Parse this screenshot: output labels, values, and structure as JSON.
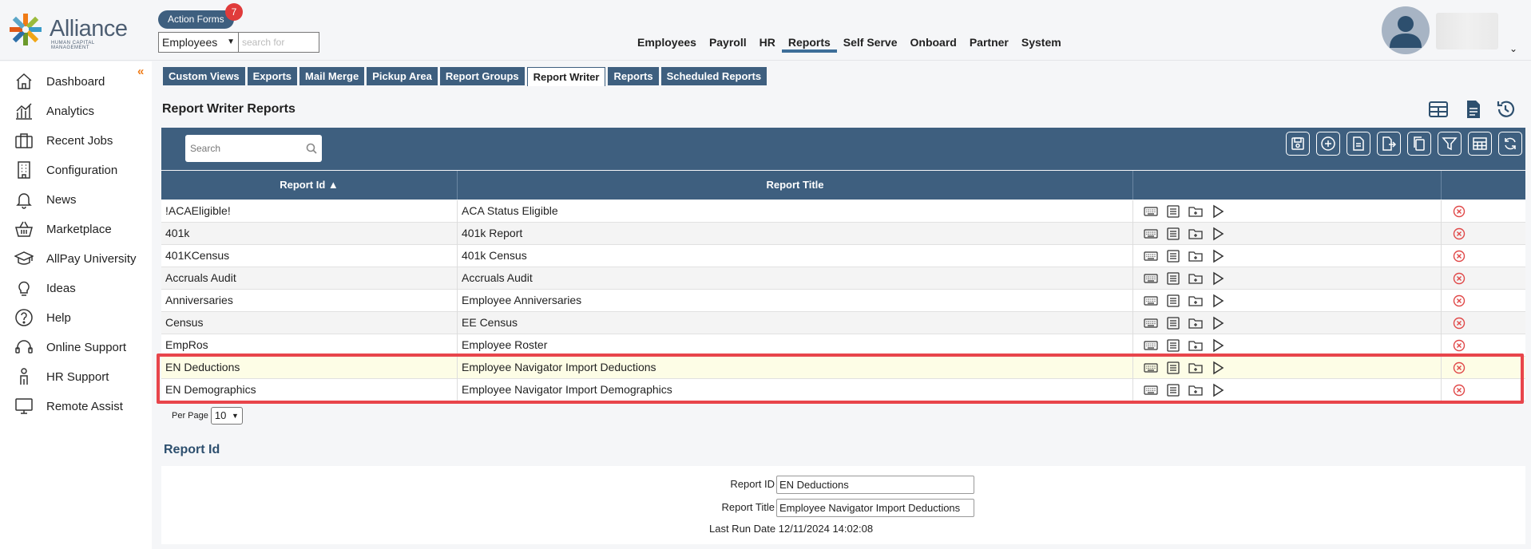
{
  "header": {
    "logo_word": "Alliance",
    "logo_sub": "HUMAN CAPITAL MANAGEMENT",
    "action_forms_label": "Action Forms",
    "action_forms_count": "7",
    "search_scope": "Employees",
    "search_placeholder": "search for",
    "nav": [
      "Employees",
      "Payroll",
      "HR",
      "Reports",
      "Self Serve",
      "Onboard",
      "Partner",
      "System"
    ],
    "active_nav": "Reports"
  },
  "sidebar": {
    "items": [
      {
        "label": "Dashboard",
        "icon": "home-icon"
      },
      {
        "label": "Analytics",
        "icon": "analytics-icon"
      },
      {
        "label": "Recent Jobs",
        "icon": "briefcase-icon"
      },
      {
        "label": "Configuration",
        "icon": "building-icon"
      },
      {
        "label": "News",
        "icon": "bell-icon"
      },
      {
        "label": "Marketplace",
        "icon": "basket-icon"
      },
      {
        "label": "AllPay University",
        "icon": "graduation-cap-icon"
      },
      {
        "label": "Ideas",
        "icon": "lightbulb-icon"
      },
      {
        "label": "Help",
        "icon": "question-icon"
      },
      {
        "label": "Online Support",
        "icon": "headset-icon"
      },
      {
        "label": "HR Support",
        "icon": "person-icon"
      },
      {
        "label": "Remote Assist",
        "icon": "monitor-icon"
      }
    ]
  },
  "tabs": [
    "Custom Views",
    "Exports",
    "Mail Merge",
    "Pickup Area",
    "Report Groups",
    "Report Writer",
    "Reports",
    "Scheduled Reports"
  ],
  "active_tab": "Report Writer",
  "page_title": "Report Writer Reports",
  "grid": {
    "search_placeholder": "Search",
    "columns": [
      "Report Id ▲",
      "Report Title",
      "",
      ""
    ],
    "rows": [
      {
        "id": "!ACAEligible!",
        "title": "ACA Status Eligible"
      },
      {
        "id": "401k",
        "title": "401k Report"
      },
      {
        "id": "401KCensus",
        "title": "401k Census"
      },
      {
        "id": "Accruals Audit",
        "title": "Accruals Audit"
      },
      {
        "id": "Anniversaries",
        "title": "Employee Anniversaries"
      },
      {
        "id": "Census",
        "title": "EE Census"
      },
      {
        "id": "EmpRos",
        "title": "Employee Roster"
      },
      {
        "id": "EN Deductions",
        "title": "Employee Navigator Import Deductions"
      },
      {
        "id": "EN Demographics",
        "title": "Employee Navigator Import Demographics"
      }
    ],
    "selected_row": 7,
    "per_page_label": "Per Page",
    "per_page_value": "10"
  },
  "detail": {
    "title": "Report Id",
    "report_id_label": "Report ID",
    "report_id_value": "EN Deductions",
    "report_title_label": "Report Title",
    "report_title_value": "Employee Navigator Import Deductions",
    "last_run_label": "Last Run Date",
    "last_run_value": "12/11/2024 14:02:08"
  },
  "colors": {
    "primary": "#3e5f7f",
    "accent_orange": "#f07b16",
    "badge_red": "#e03b3b",
    "highlight_red": "#e8454b",
    "delete_red": "#e04848"
  }
}
